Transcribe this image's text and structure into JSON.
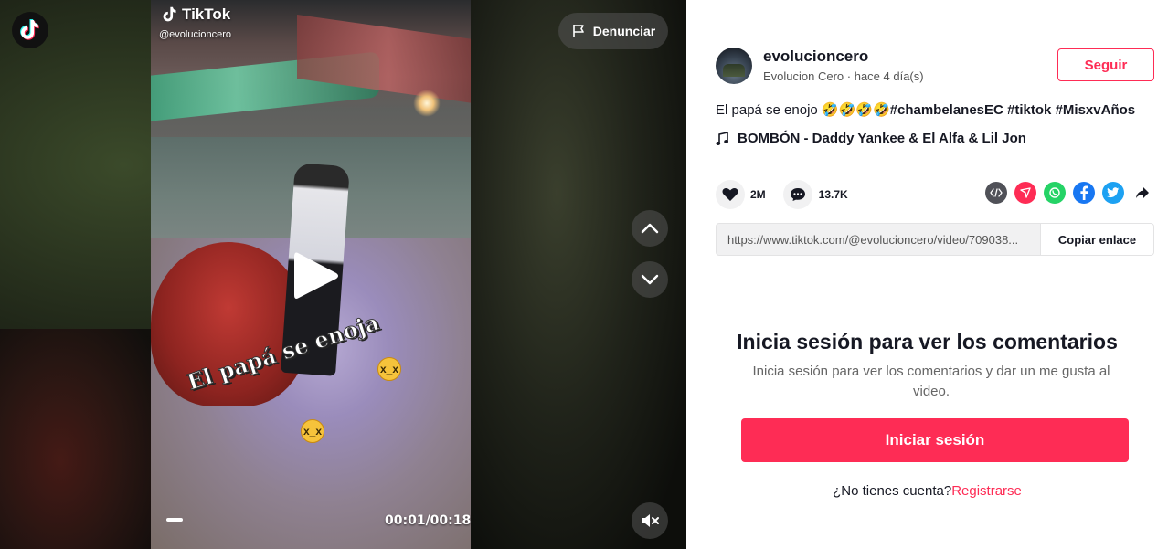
{
  "video": {
    "brand": "TikTok",
    "handle": "@evolucioncero",
    "overlay_caption": "El papá se enoja",
    "time": "00:01/00:18",
    "progress": 0.055,
    "report_label": "Denunciar"
  },
  "author": {
    "username": "evolucioncero",
    "subline": "Evolucion Cero · hace 4 día(s)",
    "follow_label": "Seguir"
  },
  "post": {
    "caption_text": "El papá se enojo ",
    "caption_emojis": "🤣🤣🤣🤣",
    "hashtags": [
      "#chambelanesEC",
      "#tiktok",
      "#MisxvAños"
    ],
    "music": "BOMBÓN - Daddy Yankee & El Alfa & Lil Jon"
  },
  "stats": {
    "likes": "2M",
    "comments": "13.7K"
  },
  "share": {
    "icons": [
      "embed-icon",
      "send-to-friends-icon",
      "whatsapp-icon",
      "facebook-icon",
      "twitter-icon",
      "share-arrow-icon"
    ]
  },
  "link": {
    "url": "https://www.tiktok.com/@evolucioncero/video/709038...",
    "copy_label": "Copiar enlace"
  },
  "login": {
    "title": "Inicia sesión para ver los comentarios",
    "subtitle": "Inicia sesión para ver los comentarios y dar un me gusta al video.",
    "button": "Iniciar sesión",
    "no_account": "¿No tienes cuenta?",
    "signup": "Registrarse"
  },
  "colors": {
    "accent": "#fe2c55",
    "whatsapp": "#25d366",
    "facebook": "#1877f2",
    "twitter": "#1da1f2"
  }
}
